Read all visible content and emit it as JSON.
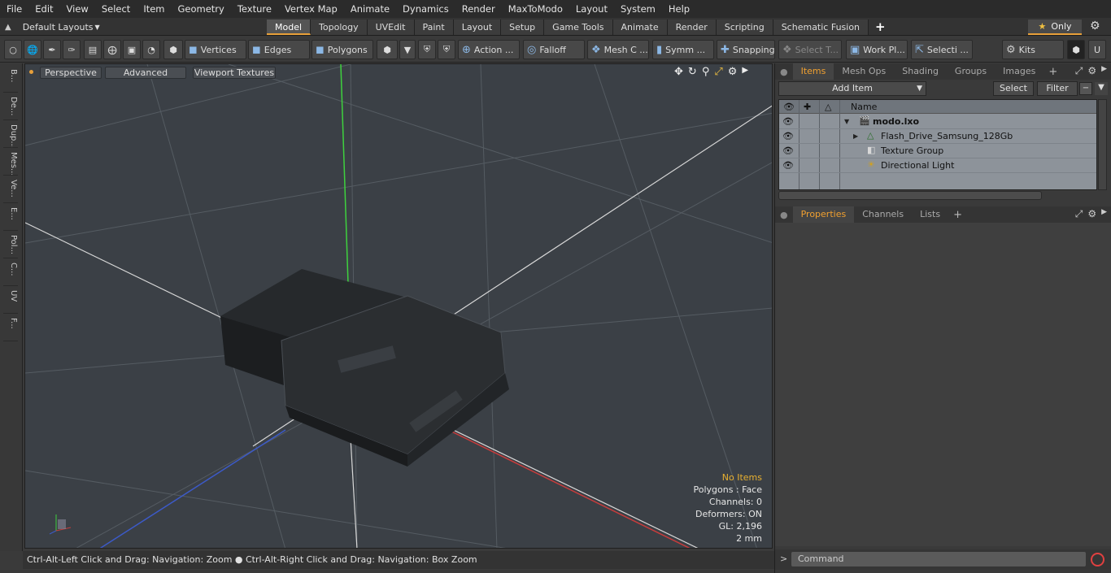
{
  "menu": [
    "File",
    "Edit",
    "View",
    "Select",
    "Item",
    "Geometry",
    "Texture",
    "Vertex Map",
    "Animate",
    "Dynamics",
    "Render",
    "MaxToModo",
    "Layout",
    "System",
    "Help"
  ],
  "layout_selector": "Default Layouts",
  "tabs": [
    "Model",
    "Topology",
    "UVEdit",
    "Paint",
    "Layout",
    "Setup",
    "Game Tools",
    "Animate",
    "Render",
    "Scripting",
    "Schematic Fusion"
  ],
  "only_label": "Only",
  "toolbar": {
    "vertices": "Vertices",
    "edges": "Edges",
    "polygons": "Polygons",
    "action": "Action ...",
    "falloff": "Falloff",
    "mesh": "Mesh C ...",
    "symm": "Symm ...",
    "snapping": "Snapping",
    "select_t": "Select T...",
    "work_pl": "Work Pl...",
    "selecti": "Selecti ...",
    "kits": "Kits"
  },
  "left_strip": [
    "B...",
    "De...",
    "Dup...",
    "Mes...",
    "Ve...",
    "E...",
    "Pol...",
    "C...",
    "UV",
    "F..."
  ],
  "viewport": {
    "perspective": "Perspective",
    "advanced": "Advanced",
    "textures": "Viewport Textures",
    "info": {
      "no_items": "No Items",
      "polygons": "Polygons : Face",
      "channels": "Channels: 0",
      "deformers": "Deformers: ON",
      "gl": "GL: 2,196",
      "unit": "2 mm"
    }
  },
  "status": "Ctrl-Alt-Left Click and Drag: Navigation: Zoom ● Ctrl-Alt-Right Click and Drag: Navigation: Box Zoom",
  "items_panel": {
    "tabs": [
      "Items",
      "Mesh Ops",
      "Shading",
      "Groups",
      "Images"
    ],
    "add_item": "Add Item",
    "select": "Select",
    "filter": "Filter",
    "col_name": "Name",
    "rows": [
      {
        "label": "modo.lxo"
      },
      {
        "label": "Flash_Drive_Samsung_128Gb"
      },
      {
        "label": "Texture Group"
      },
      {
        "label": "Directional Light"
      }
    ]
  },
  "props_panel": {
    "tabs": [
      "Properties",
      "Channels",
      "Lists"
    ]
  },
  "command": {
    "placeholder": "Command"
  },
  "colors": {
    "accent": "#e8a03a",
    "viewport_bg": "#3b4046",
    "table_bg": "#8d939a"
  }
}
